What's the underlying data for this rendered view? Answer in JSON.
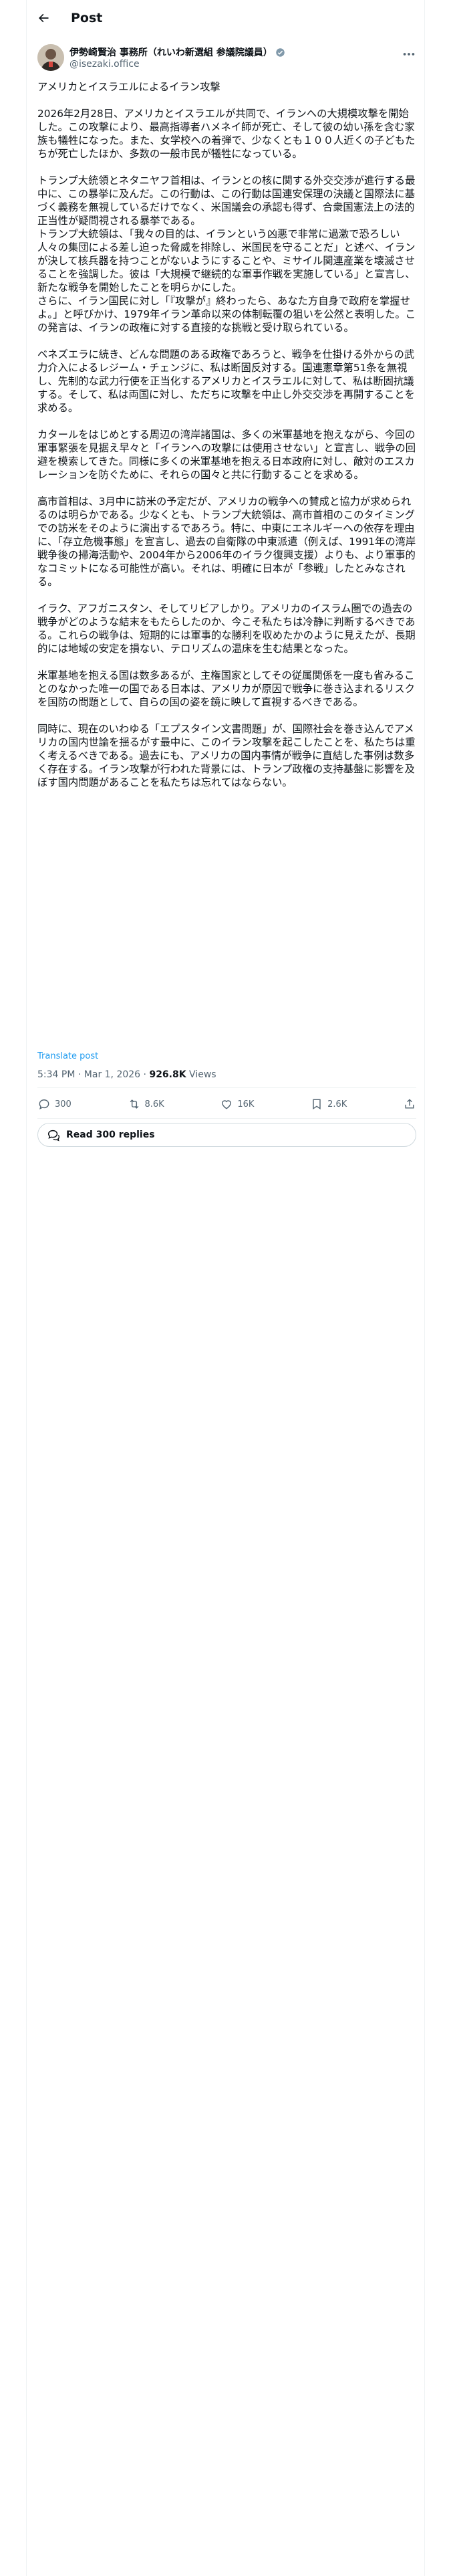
{
  "header": {
    "title": "Post"
  },
  "author": {
    "name": "伊勢崎賢治 事務所（れいわ新選組 参議院議員）",
    "handle": "@isezaki.office"
  },
  "post": {
    "paragraphs": [
      "アメリカとイスラエルによるイラン攻撃",
      "2026年2月28日、アメリカとイスラエルが共同で、イランへの大規模攻撃を開始した。この攻撃により、最高指導者ハメネイ師が死亡、そして彼の幼い孫を含む家族も犠牲になった。また、女学校への着弾で、少なくとも１００人近くの子どもたちが死亡したほか、多数の一般市民が犠牲になっている。",
      "トランプ大統領とネタニヤフ首相は、イランとの核に関する外交交渉が進行する最中に、この暴挙に及んだ。この行動は、この行動は国連安保理の決議と国際法に基づく義務を無視しているだけでなく、米国議会の承認も得ず、合衆国憲法上の法的正当性が疑問視される暴挙である。\nトランプ大統領は、「我々の目的は、イランという凶悪で非常に過激で恐ろしい人々の集団による差し迫った脅威を排除し、米国民を守ることだ」と述べ、イランが決して核兵器を持つことがないようにすることや、ミサイル関連産業を壊滅させることを強調した。彼は「大規模で継続的な軍事作戦を実施している」と宣言し、新たな戦争を開始したことを明らかにした。\nさらに、イラン国民に対し「『攻撃が』終わったら、あなた方自身で政府を掌握せよ。」と呼びかけ、1979年イラン革命以来の体制転覆の狙いを公然と表明した。この発言は、イランの政権に対する直接的な挑戦と受け取られている。",
      "ベネズエラに続き、どんな問題のある政権であろうと、戦争を仕掛ける外からの武力介入によるレジーム・チェンジに、私は断固反対する。国連憲章第51条を無視し、先制的な武力行使を正当化するアメリカとイスラエルに対して、私は断固抗議する。そして、私は両国に対し、ただちに攻撃を中止し外交交渉を再開することを求める。",
      "カタールをはじめとする周辺の湾岸諸国は、多くの米軍基地を抱えながら、今回の軍事緊張を見据え早々と「イランへの攻撃には使用させない」と宣言し、戦争の回避を模索してきた。同様に多くの米軍基地を抱える日本政府に対し、敵対のエスカレーションを防ぐために、それらの国々と共に行動することを求める。",
      "高市首相は、3月中に訪米の予定だが、アメリカの戦争への賛成と協力が求められるのは明らかである。少なくとも、トランプ大統領は、高市首相のこのタイミングでの訪米をそのように演出するであろう。特に、中東にエネルギーへの依存を理由に、「存立危機事態」を宣言し、過去の自衛隊の中東派遣（例えば、1991年の湾岸戦争後の掃海活動や、2004年から2006年のイラク復興支援）よりも、より軍事的なコミットになる可能性が高い。それは、明確に日本が「参戦」したとみなされる。",
      "イラク、アフガニスタン、そしてリビアしかり。アメリカのイスラム圏での過去の戦争がどのような結末をもたらしたのか、今こそ私たちは冷静に判断するべきである。これらの戦争は、短期的には軍事的な勝利を収めたかのように見えたが、長期的には地域の安定を損ない、テロリズムの温床を生む結果となった。",
      "米軍基地を抱える国は数多あるが、主権国家としてその従属関係を一度も省みることのなかった唯一の国である日本は、アメリカが原因で戦争に巻き込まれるリスクを国防の問題として、自らの国の姿を鏡に映して直視するべきである。",
      "同時に、現在のいわゆる「エプスタイン文書問題」が、国際社会を巻き込んでアメリカの国内世論を揺るがす最中に、このイラン攻撃を起こしたことを、私たちは重く考えるべきである。過去にも、アメリカの国内事情が戦争に直結した事例は数多く存在する。イラン攻撃が行われた背景には、トランプ政権の支持基盤に影響を及ぼす国内問題があることを私たちは忘れてはならない。"
    ]
  },
  "translate_label": "Translate post",
  "meta": {
    "time": "5:34 PM",
    "sep1": " · ",
    "date": "Mar 1, 2026",
    "sep2": " · ",
    "views_count": "926.8K",
    "views_label": " Views"
  },
  "actions": {
    "replies": "300",
    "reposts": "8.6K",
    "likes": "16K",
    "bookmarks": "2.6K"
  },
  "read_replies_label": "Read 300 replies"
}
